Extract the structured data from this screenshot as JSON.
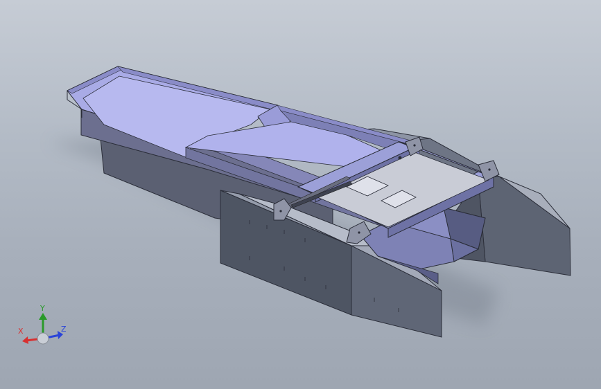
{
  "triad": {
    "x_label": "X",
    "y_label": "Y",
    "z_label": "Z",
    "x_color": "#d83030",
    "y_color": "#2a9a2a",
    "z_color": "#2a44d8"
  }
}
